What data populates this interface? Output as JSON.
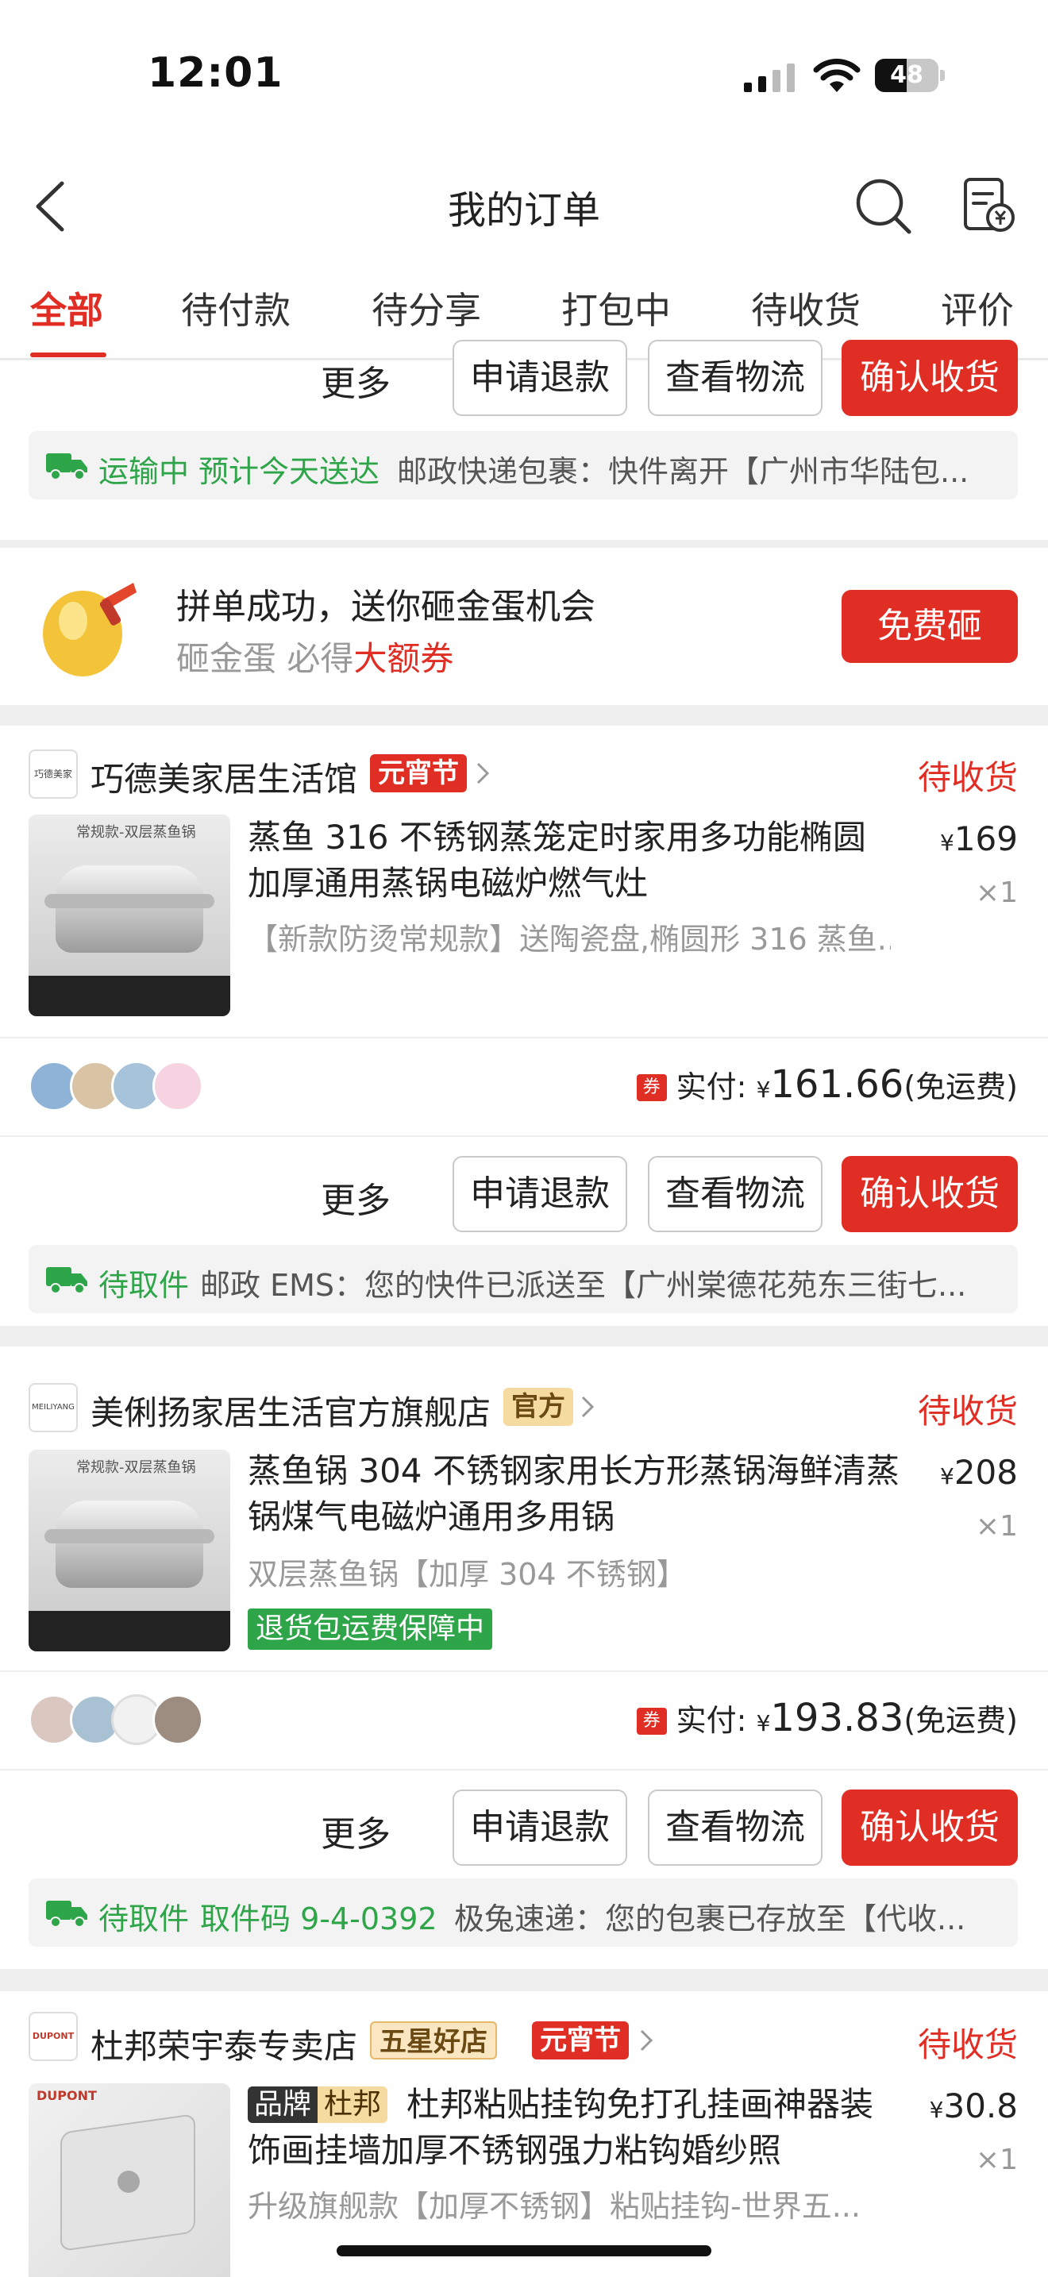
{
  "status_bar": {
    "time": "12:01",
    "battery": "48"
  },
  "navbar": {
    "title": "我的订单"
  },
  "tabs": [
    "全部",
    "待付款",
    "待分享",
    "打包中",
    "待收货",
    "评价"
  ],
  "actions": {
    "more": "更多",
    "refund": "申请退款",
    "track": "查看物流",
    "confirm": "确认收货"
  },
  "top_logistics": {
    "status": "运输中",
    "eta": "预计今天送达",
    "detail": "邮政快递包裹：快件离开【广州市华陆包..."
  },
  "promo": {
    "title": "拼单成功，送你砸金蛋机会",
    "sub_prefix": "砸金蛋 必得",
    "sub_highlight": "大额券",
    "button": "免费砸"
  },
  "orders": [
    {
      "store": "巧德美家居生活馆",
      "logo_text": "巧德美家",
      "badge": "元宵节",
      "status": "待收货",
      "thumb_label": "常规款-双层蒸鱼锅",
      "title": "蒸鱼 316 不锈钢蒸笼定时家用多功能椭圆加厚通用蒸锅电磁炉燃气灶",
      "spec": "【新款防烫常规款】送陶瓷盘,椭圆形 316 蒸鱼...",
      "price": "169",
      "qty": "×1",
      "pay_label": "实付:",
      "pay_amount": "161.66",
      "shipping": "(免运费)",
      "coupon": "券",
      "logistics_status": "待取件",
      "logistics_detail": "邮政 EMS：您的快件已派送至【广州棠德花苑东三街七..."
    },
    {
      "store": "美俐扬家居生活官方旗舰店",
      "logo_text": "MEILIYANG",
      "badge": "官方",
      "status": "待收货",
      "thumb_label": "常规款-双层蒸鱼锅",
      "title": "蒸鱼锅 304 不锈钢家用长方形蒸锅海鲜清蒸锅煤气电磁炉通用多用锅",
      "spec": "双层蒸鱼锅【加厚 304 不锈钢】",
      "guarantee": "退货包运费保障中",
      "price": "208",
      "qty": "×1",
      "pay_label": "实付:",
      "pay_amount": "193.83",
      "shipping": "(免运费)",
      "coupon": "券",
      "logistics_status": "待取件",
      "logistics_code": "取件码 9-4-0392",
      "logistics_detail": "极兔速递：您的包裹已存放至【代收..."
    },
    {
      "store": "杜邦荣宇泰专卖店",
      "logo_text": "DUPONT",
      "badge_gold": "五星好店",
      "badge": "元宵节",
      "status": "待收货",
      "thumb_label": "DUPONT",
      "brand_tag": "品牌",
      "brand_name": "杜邦",
      "title": "杜邦粘贴挂钩免打孔挂画神器装饰画挂墙加厚不锈钢强力粘钩婚纱照",
      "spec": "升级旗舰款【加厚不锈钢】粘贴挂钩-世界五...",
      "price": "30.8",
      "qty": "×1"
    }
  ],
  "currency": "¥",
  "colors": {
    "accent": "#e02e24",
    "green": "#2fa54a",
    "gold": "#f6dba0"
  }
}
